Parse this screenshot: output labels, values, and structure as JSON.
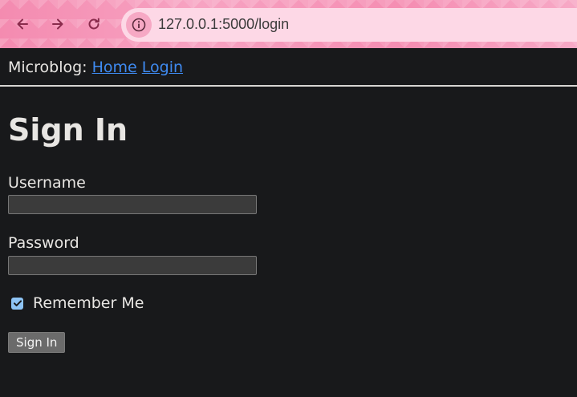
{
  "browser": {
    "url": "127.0.0.1:5000/login",
    "back_icon": "back-arrow-icon",
    "forward_icon": "forward-arrow-icon",
    "reload_icon": "reload-icon",
    "info_icon": "info-icon"
  },
  "nav": {
    "brand": "Microblog:",
    "links": [
      {
        "label": "Home"
      },
      {
        "label": "Login"
      }
    ]
  },
  "main": {
    "title": "Sign In",
    "username_label": "Username",
    "username_value": "",
    "password_label": "Password",
    "password_value": "",
    "remember_label": "Remember Me",
    "remember_checked": true,
    "submit_label": "Sign In"
  },
  "colors": {
    "background": "#18191b",
    "link": "#3f8bf2",
    "text": "#e8e6e3",
    "checkbox": "#8ec4f5"
  }
}
